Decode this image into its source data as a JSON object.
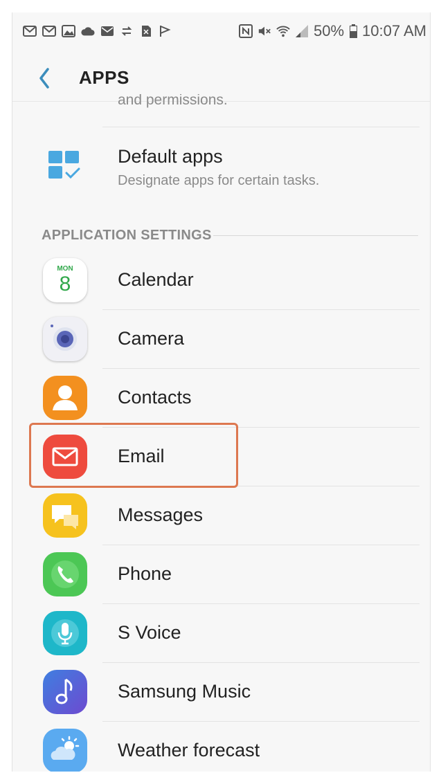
{
  "status_bar": {
    "battery": "50%",
    "time": "10:07 AM",
    "icons": [
      "gmail-icon",
      "gmail-icon",
      "gallery-icon",
      "cloud-icon",
      "mail-icon",
      "sync-icon",
      "sim-icon",
      "flag-icon",
      "nfc-icon",
      "mute-icon",
      "wifi-icon",
      "signal-icon",
      "battery-icon"
    ]
  },
  "header": {
    "title": "APPS",
    "back_icon": "chevron-left-icon"
  },
  "partial_item": {
    "text": "and permissions."
  },
  "default_apps": {
    "title": "Default apps",
    "subtitle": "Designate apps for certain tasks.",
    "icon": "default-apps-icon"
  },
  "section": {
    "title": "APPLICATION SETTINGS"
  },
  "apps": [
    {
      "label": "Calendar",
      "icon": "calendar-icon",
      "icon_text_top": "MON",
      "icon_text_day": "8"
    },
    {
      "label": "Camera",
      "icon": "camera-icon"
    },
    {
      "label": "Contacts",
      "icon": "contacts-icon"
    },
    {
      "label": "Email",
      "icon": "email-icon"
    },
    {
      "label": "Messages",
      "icon": "messages-icon"
    },
    {
      "label": "Phone",
      "icon": "phone-icon"
    },
    {
      "label": "S Voice",
      "icon": "microphone-icon"
    },
    {
      "label": "Samsung Music",
      "icon": "music-note-icon"
    },
    {
      "label": "Weather forecast",
      "icon": "weather-icon"
    }
  ],
  "colors": {
    "accent": "#3c8dbc",
    "highlight": "#dd7850",
    "calendar": "#ffffff",
    "camera": "#f0f0f5",
    "contacts": "#f3901f",
    "email": "#ee4b3e",
    "messages": "#f6c21e",
    "phone": "#4cc755",
    "svoice": "#1eb7c9",
    "music": "#5563d8",
    "weather": "#5aaaf0"
  }
}
